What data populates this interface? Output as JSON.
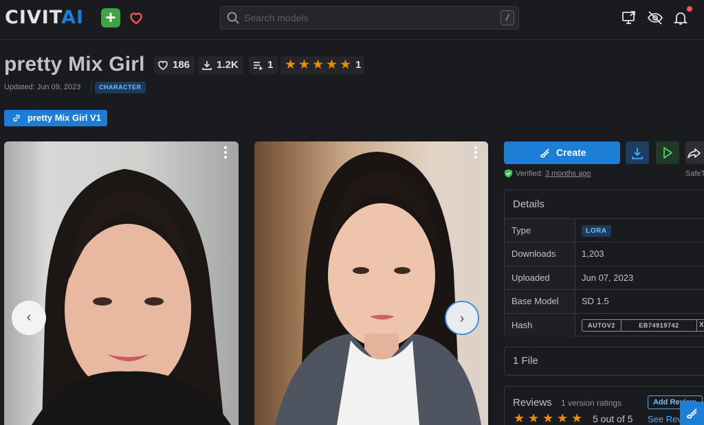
{
  "header": {
    "logo_left": "CIVIT",
    "logo_right": "AI",
    "add_label": "+",
    "search_placeholder": "Search models",
    "search_shortcut": "/",
    "icons": [
      "monitor-upload-icon",
      "eye-off-icon",
      "bell-icon"
    ]
  },
  "model": {
    "title": "pretty Mix Girl",
    "likes": "186",
    "downloads": "1.2K",
    "collections": "1",
    "rating_count": "1",
    "updated": "Updated: Jun 09, 2023",
    "category": "CHARACTER",
    "version_label": "pretty Mix Girl V1"
  },
  "actions": {
    "create_label": "Create",
    "verified_prefix": "Verified:",
    "verified_when": "3 months ago",
    "safe_label": "SafeT"
  },
  "details": {
    "heading": "Details",
    "rows": [
      {
        "key": "Type",
        "value": "LORA"
      },
      {
        "key": "Downloads",
        "value": "1,203"
      },
      {
        "key": "Uploaded",
        "value": "Jun 07, 2023"
      },
      {
        "key": "Base Model",
        "value": "SD 1.5"
      },
      {
        "key": "Hash",
        "value": ""
      }
    ],
    "hash_type": "AUTOV2",
    "hash_value": "EB74919742",
    "hash_extra": "X"
  },
  "files": {
    "label": "1 File"
  },
  "reviews": {
    "title": "Reviews",
    "count_label": "1 version ratings",
    "add_label": "Add Review",
    "score_label": "5 out of 5",
    "see_label": "See Reviews",
    "rating": 5
  },
  "colors": {
    "accent": "#1c7ed6",
    "star": "#f08c00",
    "background": "#1a1b1e"
  }
}
